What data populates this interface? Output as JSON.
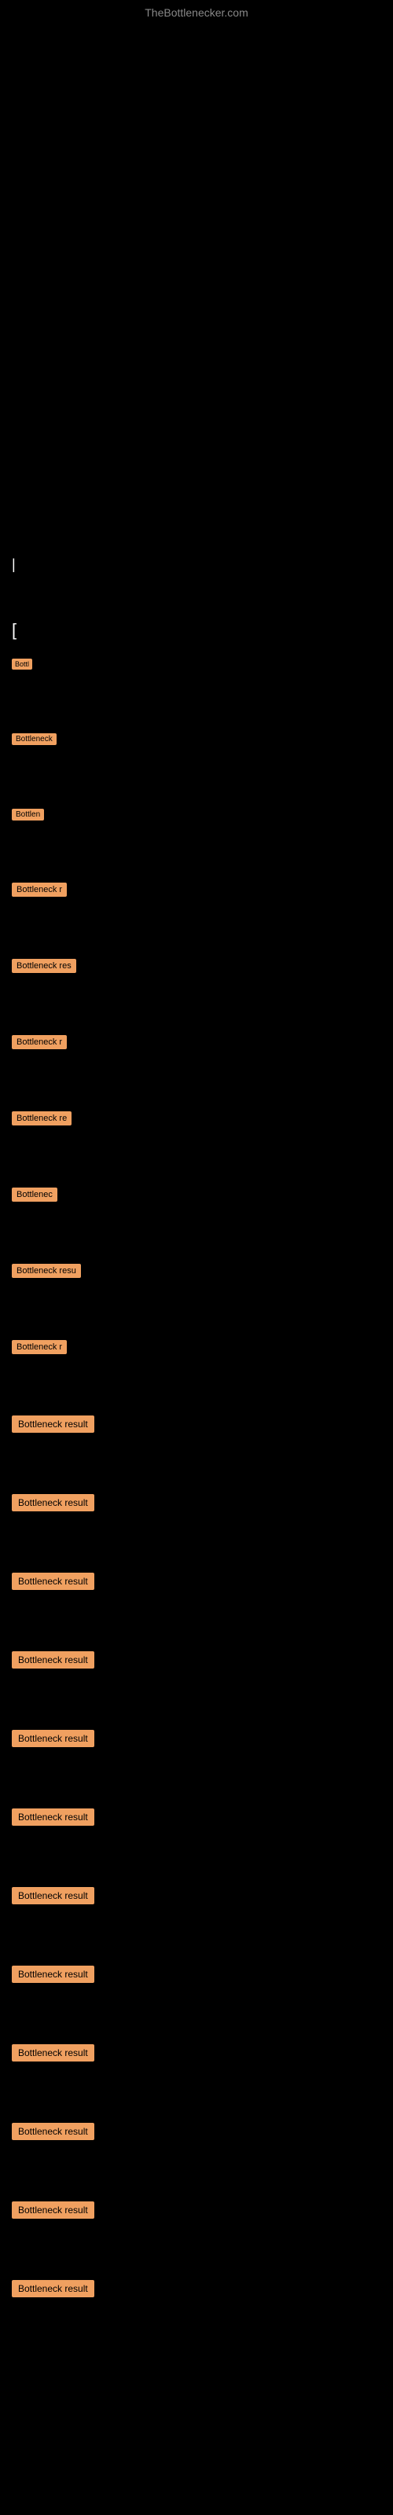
{
  "header": {
    "title": "TheBottlenecker.com"
  },
  "cursor": {
    "symbol": "|"
  },
  "bracket": {
    "symbol": "["
  },
  "items": [
    {
      "label": "Bottl",
      "size": 1
    },
    {
      "label": "Bottleneck",
      "size": 2
    },
    {
      "label": "Bottlen",
      "size": 2
    },
    {
      "label": "Bottleneck r",
      "size": 3
    },
    {
      "label": "Bottleneck res",
      "size": 3
    },
    {
      "label": "Bottleneck r",
      "size": 3
    },
    {
      "label": "Bottleneck re",
      "size": 3
    },
    {
      "label": "Bottlenec",
      "size": 3
    },
    {
      "label": "Bottleneck resu",
      "size": 3
    },
    {
      "label": "Bottleneck r",
      "size": 3
    },
    {
      "label": "Bottleneck result",
      "size": 4
    },
    {
      "label": "Bottleneck result",
      "size": 4
    },
    {
      "label": "Bottleneck result",
      "size": 4
    },
    {
      "label": "Bottleneck result",
      "size": 4
    },
    {
      "label": "Bottleneck result",
      "size": 4
    },
    {
      "label": "Bottleneck result",
      "size": 4
    },
    {
      "label": "Bottleneck result",
      "size": 4
    },
    {
      "label": "Bottleneck result",
      "size": 4
    },
    {
      "label": "Bottleneck result",
      "size": 4
    },
    {
      "label": "Bottleneck result",
      "size": 4
    },
    {
      "label": "Bottleneck result",
      "size": 4
    },
    {
      "label": "Bottleneck result",
      "size": 4
    }
  ]
}
